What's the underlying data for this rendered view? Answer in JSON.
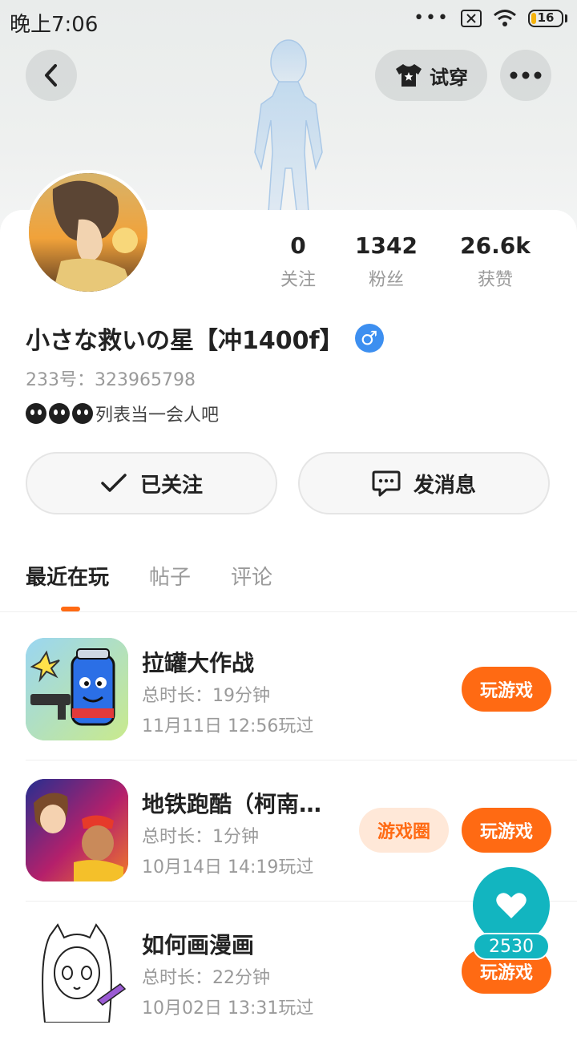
{
  "status_bar": {
    "time": "晚上7:06",
    "battery": "16"
  },
  "header": {
    "try_on_label": "试穿"
  },
  "profile": {
    "stats": [
      {
        "value": "0",
        "label": "关注"
      },
      {
        "value": "1342",
        "label": "粉丝"
      },
      {
        "value": "26.6k",
        "label": "获赞"
      }
    ],
    "username": "小さな救いの星【冲1400f】",
    "gender_symbol": "♂",
    "uid": "233号：323965798",
    "bio": "列表当一会人吧",
    "follow_label": "已关注",
    "message_label": "发消息"
  },
  "tabs": [
    {
      "label": "最近在玩",
      "active": true
    },
    {
      "label": "帖子",
      "active": false
    },
    {
      "label": "评论",
      "active": false
    }
  ],
  "games": [
    {
      "title": "拉罐大作战",
      "duration": "总时长：19分钟",
      "played": "11月11日 12:56玩过",
      "play_label": "玩游戏",
      "circle_label": ""
    },
    {
      "title": "地铁跑酷（柯南联…",
      "duration": "总时长：1分钟",
      "played": "10月14日 14:19玩过",
      "play_label": "玩游戏",
      "circle_label": "游戏圈"
    },
    {
      "title": "如何画漫画",
      "duration": "总时长：22分钟",
      "played": "10月02日 13:31玩过",
      "play_label": "玩游戏",
      "circle_label": ""
    }
  ],
  "like_fab": {
    "count": "2530"
  },
  "colors": {
    "accent": "#ff6a13",
    "fab": "#12b5c0",
    "gender": "#3d8ff0"
  }
}
